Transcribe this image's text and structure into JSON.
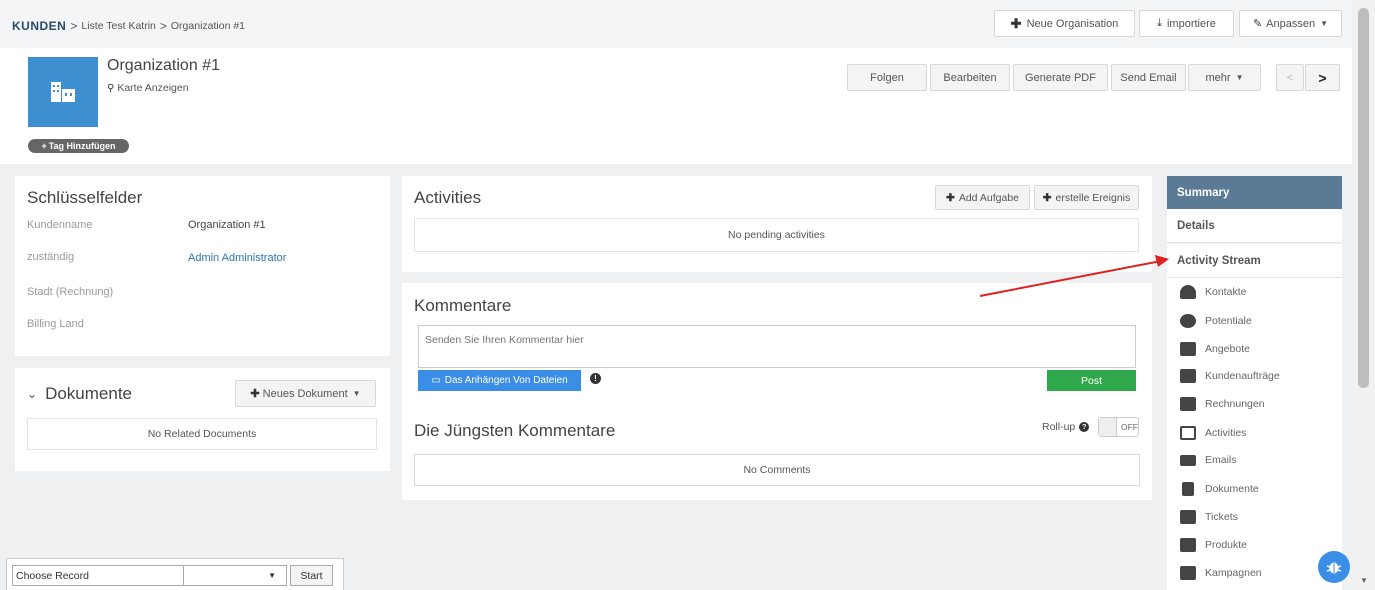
{
  "breadcrumb": {
    "brand": "KUNDEN",
    "sep1": ">",
    "list": "Liste Test Katrin",
    "sep2": ">",
    "record": "Organization #1"
  },
  "toolbar": {
    "new_org": "Neue Organisation",
    "import": "importiere",
    "customize": "Anpassen"
  },
  "record": {
    "title": "Organization #1",
    "map_link": "Karte Anzeigen",
    "add_tag": "Tag Hinzufügen"
  },
  "actions": {
    "follow": "Folgen",
    "edit": "Bearbeiten",
    "pdf": "Generate PDF",
    "email": "Send Email",
    "more": "mehr"
  },
  "keyfields": {
    "title": "Schlüsselfelder",
    "rows": [
      {
        "label": "Kundenname",
        "value": "Organization #1"
      },
      {
        "label": "zuständig",
        "value": "Admin Administrator"
      },
      {
        "label": "Stadt (Rechnung)",
        "value": ""
      },
      {
        "label": "Billing Land",
        "value": ""
      }
    ]
  },
  "documents": {
    "title": "Dokumente",
    "new_button": "Neues Dokument",
    "empty": "No Related Documents"
  },
  "activities": {
    "title": "Activities",
    "add_task": "Add Aufgabe",
    "add_event": "erstelle Ereignis",
    "empty": "No pending activities"
  },
  "comments": {
    "title": "Kommentare",
    "placeholder": "Senden Sie Ihren Kommentar hier",
    "attach": "Das Anhängen Von Dateien",
    "post": "Post",
    "recent_title": "Die Jüngsten Kommentare",
    "rollup_label": "Roll-up",
    "rollup_state": "OFF",
    "empty": "No Comments"
  },
  "sidebar": {
    "summary": "Summary",
    "details": "Details",
    "activity_stream": "Activity Stream",
    "related": [
      {
        "label": "Kontakte",
        "icon": "person-icon"
      },
      {
        "label": "Potentiale",
        "icon": "moneybag-icon"
      },
      {
        "label": "Angebote",
        "icon": "quote-icon"
      },
      {
        "label": "Kundenaufträge",
        "icon": "salesorder-icon"
      },
      {
        "label": "Rechnungen",
        "icon": "invoice-icon"
      },
      {
        "label": "Activities",
        "icon": "calendar-icon"
      },
      {
        "label": "Emails",
        "icon": "envelope-icon"
      },
      {
        "label": "Dokumente",
        "icon": "document-icon"
      },
      {
        "label": "Tickets",
        "icon": "ticket-icon"
      },
      {
        "label": "Produkte",
        "icon": "box-icon"
      },
      {
        "label": "Kampagnen",
        "icon": "megaphone-icon"
      }
    ]
  },
  "footer": {
    "choose": "Choose Record",
    "start": "Start"
  },
  "colors": {
    "active_nav": "#5a7a96",
    "attach_btn": "#3a8ee6",
    "post_btn": "#2ea84a",
    "arrow": "#e02020",
    "bug_btn": "#3a8ee6"
  }
}
